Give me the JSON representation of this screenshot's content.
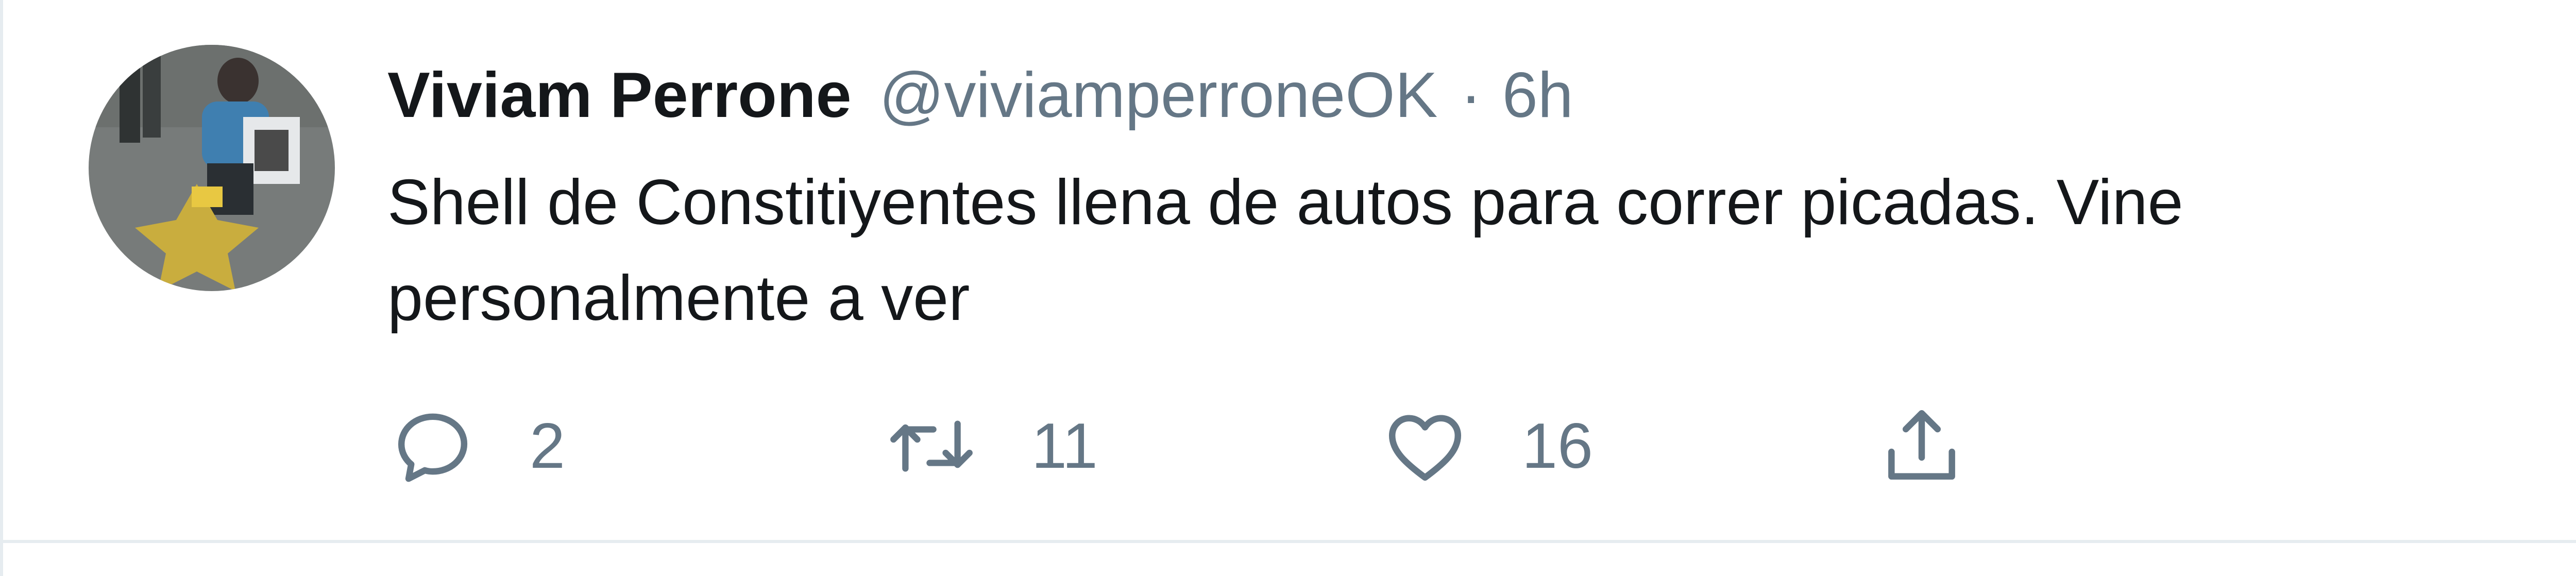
{
  "tweet": {
    "author_name": "Viviam Perrone",
    "handle": "@viviamperroneOK",
    "separator": "·",
    "time": "6h",
    "text": "Shell de Constitiyentes llena de autos para correr picadas. Vine personalmente a ver",
    "avatar_icon": "avatar-photo"
  },
  "actions": {
    "reply": {
      "icon": "reply-icon",
      "count": "2"
    },
    "retweet": {
      "icon": "retweet-icon",
      "count": "11"
    },
    "like": {
      "icon": "heart-icon",
      "count": "16"
    },
    "share": {
      "icon": "share-icon"
    }
  },
  "colors": {
    "name": "#14171a",
    "secondary": "#657786",
    "divider": "#e6ecf0"
  }
}
